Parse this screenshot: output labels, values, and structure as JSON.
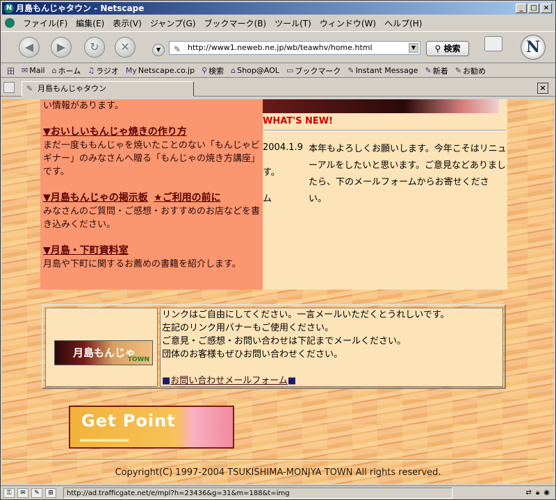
{
  "window": {
    "title": "月島もんじゃタウン - Netscape"
  },
  "menu": [
    "ファイル(F)",
    "編集(E)",
    "表示(V)",
    "ジャンプ(G)",
    "ブックマーク(B)",
    "ツール(T)",
    "ウィンドウ(W)",
    "ヘルプ(H)"
  ],
  "navbar": {
    "url": "http://www1.neweb.ne.jp/wb/teawhv/home.html",
    "search_label": "検索"
  },
  "personal_toolbar": [
    {
      "icon": "mail-icon",
      "glyph": "✉",
      "label": "Mail"
    },
    {
      "icon": "home-icon",
      "glyph": "⌂",
      "label": "ホーム"
    },
    {
      "icon": "radio-icon",
      "glyph": "♫",
      "label": "ラジオ"
    },
    {
      "icon": "my-netscape-icon",
      "glyph": "My",
      "label": "Netscape.co.jp"
    },
    {
      "icon": "search-icon",
      "glyph": "⚲",
      "label": "検索"
    },
    {
      "icon": "shop-icon",
      "glyph": "⌂",
      "label": "Shop@AOL"
    },
    {
      "icon": "folder-icon",
      "glyph": "▭",
      "label": "ブックマーク"
    },
    {
      "icon": "im-icon",
      "glyph": "✎",
      "label": "Instant Message"
    },
    {
      "icon": "bookmark-icon",
      "glyph": "✎",
      "label": "新着"
    },
    {
      "icon": "bookmark-icon",
      "glyph": "✎",
      "label": "お勧め"
    }
  ],
  "tab": {
    "label": "月島もんじゃタウン"
  },
  "left": {
    "intro": "い情報があります。",
    "sections": [
      {
        "heading": "▼おいしいもんじゃ焼きの作り方",
        "text": "まだ一度ももんじゃを焼いたことのない「もんじゃビギナー」のみなさんへ贈る「もんじゃの焼き方講座」です。"
      },
      {
        "heading": "▼月島もんじゃの掲示板",
        "heading2": "★ご利用の前に",
        "text": "みなさんのご質問・ご感想・おすすめのお店などを書き込みください。"
      },
      {
        "heading": "▼月島・下町資料室",
        "text": "月島や下町に関するお薦めの書籍を紹介します。"
      }
    ]
  },
  "right": {
    "whats_new": "WHAT'S NEW!",
    "news_date": "2004.1.9",
    "news_text": "本年もよろしくお願いします。今年こそはリニューアルをしたいと思います。ご意見などありましたら、下のメールフォームからお寄せください。",
    "frag1": "す。",
    "frag2": "ム"
  },
  "link_section": {
    "banner_text": "月島もんじゃ",
    "banner_sub": "TOWN",
    "lines": [
      "リンクはご自由にしてください。一言メールいただくとうれしいです。",
      "左記のリンク用バナーもご使用ください。",
      "ご意見・ご感想・お問い合わせは下記までメールください。",
      "団体のお客様もぜひお問い合わせください。"
    ],
    "mail_link": "お問い合わせメールフォーム"
  },
  "getpoint": {
    "label": "Get Point"
  },
  "copyright": "Copyright(C) 1997-2004 TSUKISHIMA-MONJYA TOWN All rights reserved.",
  "status": {
    "text": "http://ad.trafficgate.net/e/mpl?h=23436&g=31&m=188&t=img"
  }
}
